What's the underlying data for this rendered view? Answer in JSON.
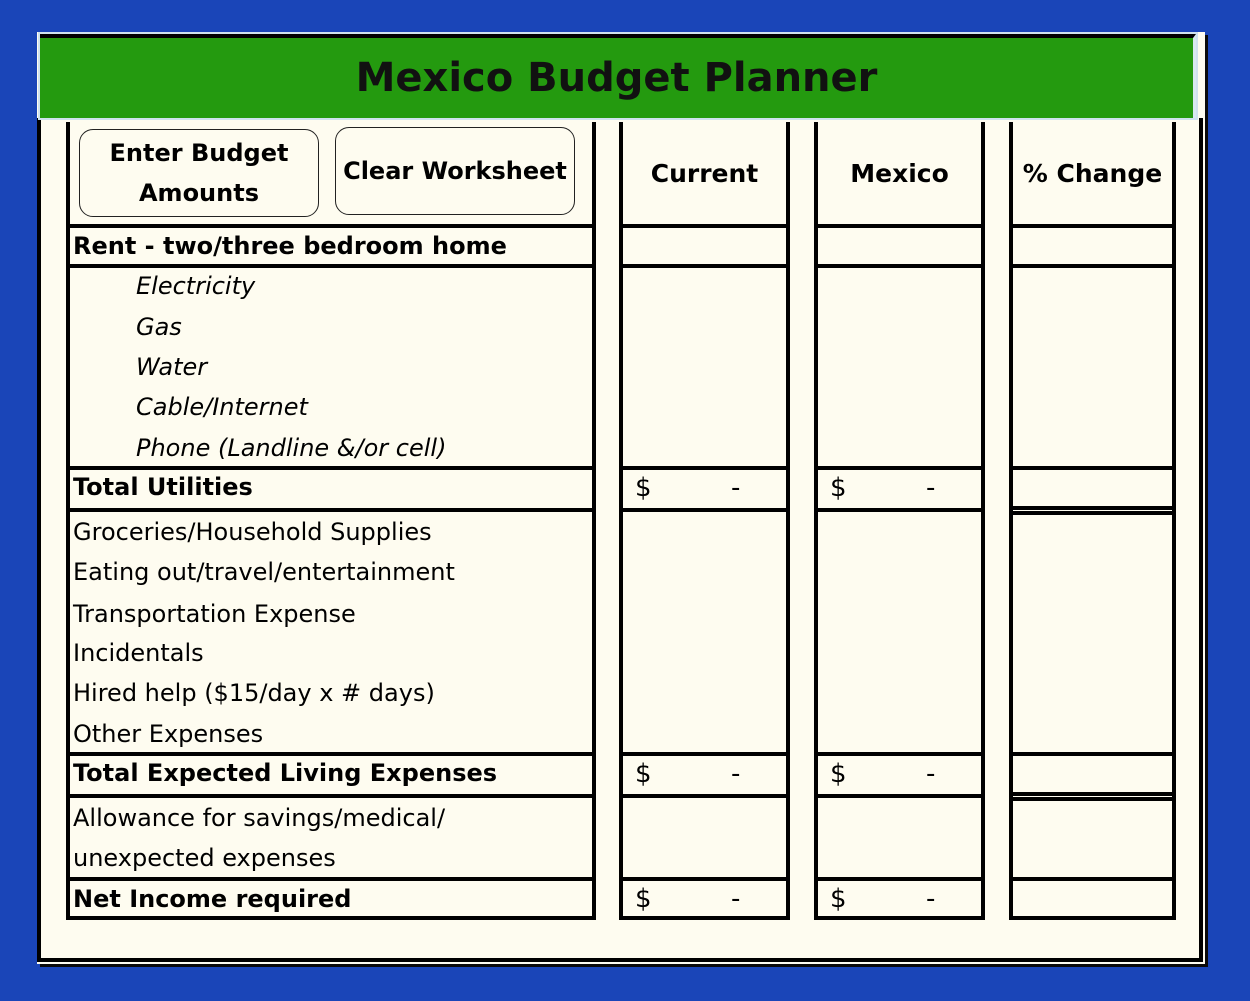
{
  "title": "Mexico Budget Planner",
  "buttons": {
    "enter_budget_line1": "Enter Budget",
    "enter_budget_line2": "Amounts",
    "clear_worksheet": "Clear Worksheet"
  },
  "columns": [
    "Current",
    "Mexico",
    "% Change"
  ],
  "rows": {
    "rent": "Rent - two/three bedroom home",
    "utilities": [
      "Electricity",
      "Gas",
      "Water",
      "Cable/Internet",
      "Phone (Landline &/or cell)"
    ],
    "total_utilities": "Total Utilities",
    "living": [
      "Groceries/Household Supplies",
      "Eating out/travel/entertainment",
      "Transportation Expense",
      "Incidentals",
      "Hired help ($15/day x # days)",
      "Other Expenses"
    ],
    "total_living": "Total Expected Living Expenses",
    "allowance_line1": "Allowance for savings/medical/",
    "allowance_line2": "unexpected expenses",
    "net_income": "Net Income required"
  },
  "totals": {
    "currency_symbol": "$",
    "total_utilities": {
      "current": "-",
      "mexico": "-",
      "pct_change": ""
    },
    "total_living": {
      "current": "-",
      "mexico": "-",
      "pct_change": ""
    },
    "net_income": {
      "current": "-",
      "mexico": "-",
      "pct_change": ""
    }
  },
  "colors": {
    "background": "#1a45b8",
    "title_bar": "#249a0f",
    "sheet": "#fefcf0"
  }
}
